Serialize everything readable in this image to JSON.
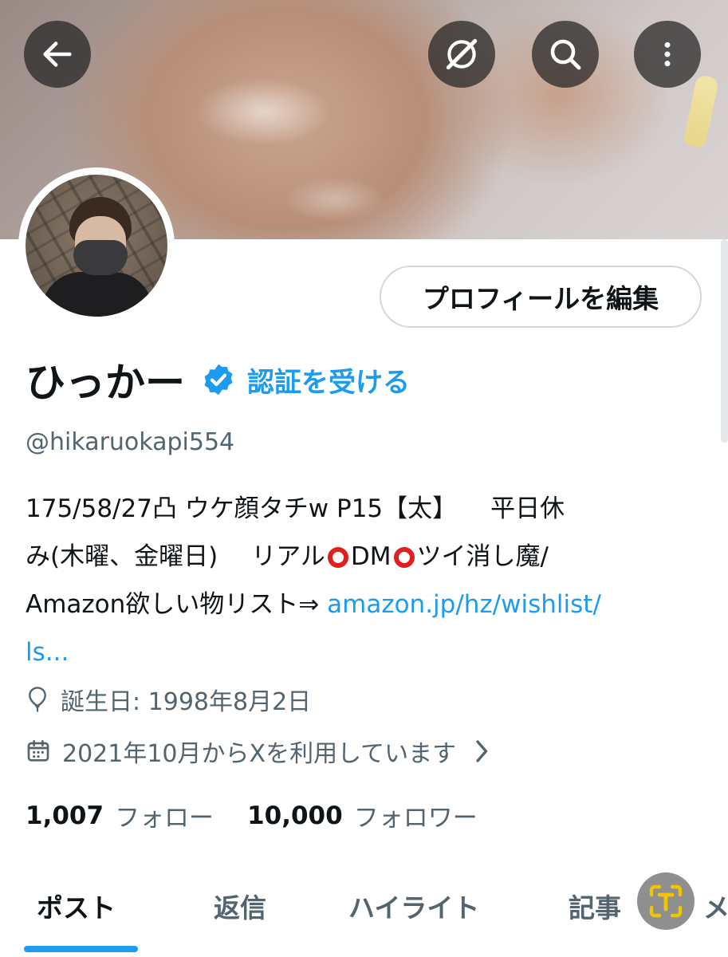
{
  "header": {
    "back_icon": "arrow-left-icon",
    "grok_icon": "grok-icon",
    "search_icon": "search-icon",
    "more_icon": "more-vertical-icon"
  },
  "profile": {
    "edit_button": "プロフィールを編集",
    "display_name": "ひっかー",
    "verified_cta": "認証を受ける",
    "handle": "@hikaruokapi554",
    "bio": {
      "line1_a": "175/58/27凸 ウケ顔タチw P15【太】",
      "line1_b": "平日休",
      "line2_a": "み(木曜、金曜日)",
      "line2_b": "リアル",
      "line2_c": "DM",
      "line2_d": "ツイ消し魔/",
      "line3_a": "Amazon欲しい物リスト⇒ ",
      "line3_link": "amazon.jp/hz/wishlist/",
      "line4_link": "ls..."
    },
    "birthday": "誕生日: 1998年8月2日",
    "joined": "2021年10月からXを利用しています",
    "following_count": "1,007",
    "following_label": "フォロー",
    "followers_count": "10,000",
    "followers_label": "フォロワー"
  },
  "tabs": [
    {
      "label": "ポスト",
      "active": true
    },
    {
      "label": "返信",
      "active": false
    },
    {
      "label": "ハイライト",
      "active": false
    },
    {
      "label": "記事",
      "active": false
    },
    {
      "label": "メ",
      "active": false
    }
  ],
  "colors": {
    "accent": "#1d9bf0",
    "text_primary": "#0f1419",
    "text_secondary": "#536471",
    "border": "#cfd9de"
  }
}
